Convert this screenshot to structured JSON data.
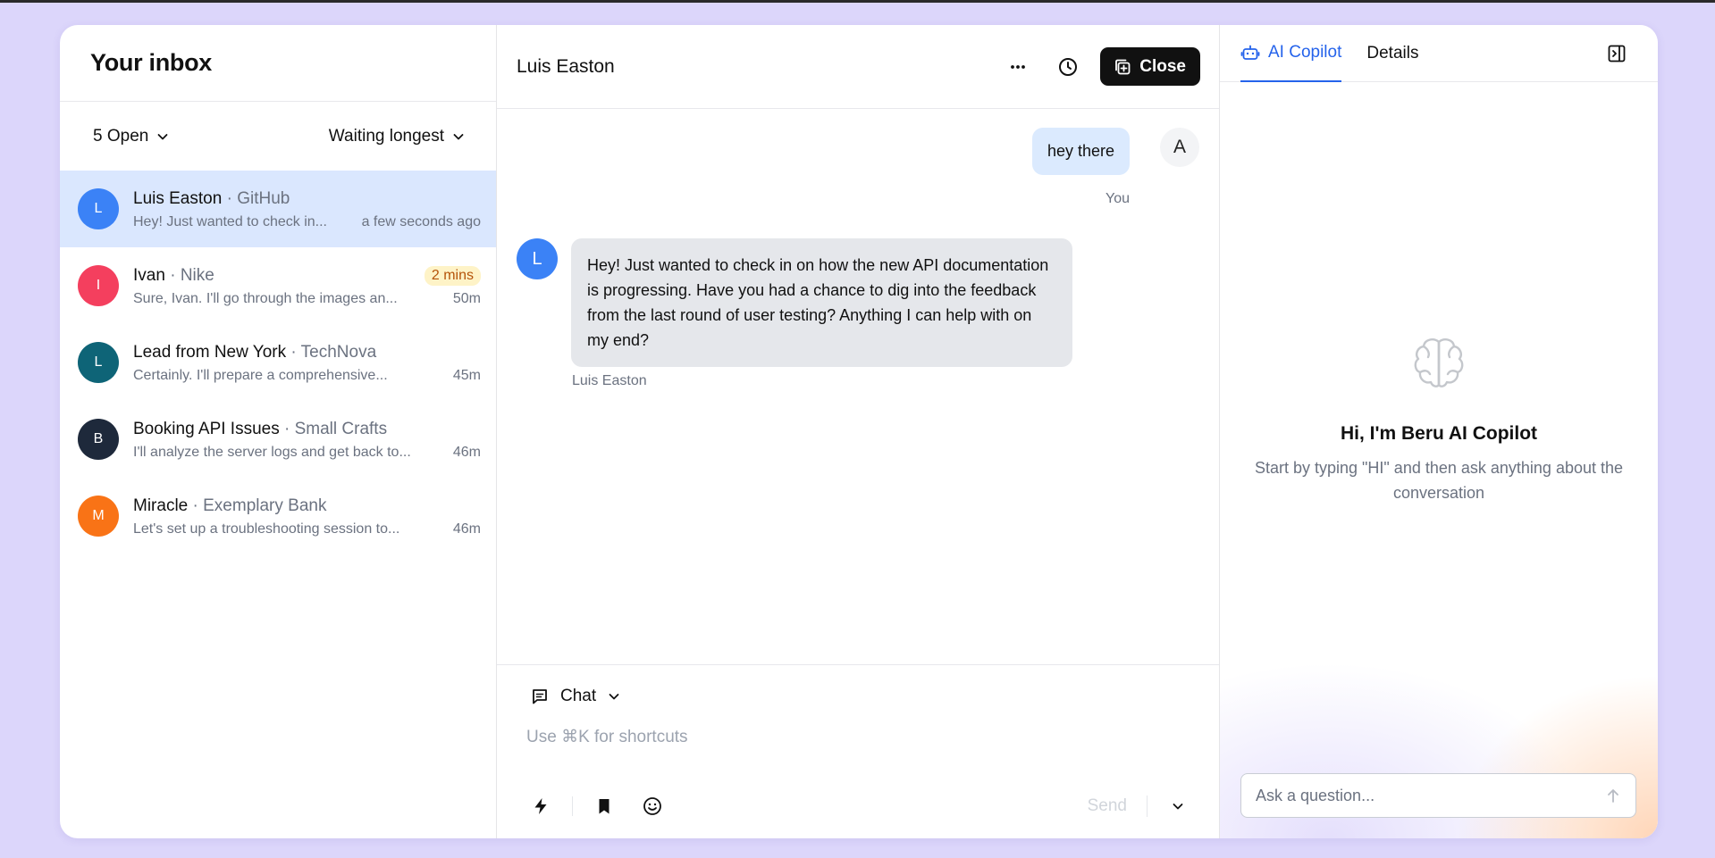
{
  "inbox": {
    "title": "Your inbox",
    "filter_status": "5 Open",
    "sort": "Waiting longest",
    "conversations": [
      {
        "initial": "L",
        "name": "Luis Easton",
        "company": "GitHub",
        "preview": "Hey! Just wanted to check in...",
        "time": "a few seconds ago",
        "badge": "",
        "color": "#3b82f6"
      },
      {
        "initial": "I",
        "name": "Ivan",
        "company": "Nike",
        "preview": "Sure, Ivan. I'll go through the images an...",
        "time": "50m",
        "badge": "2 mins",
        "color": "#f43f5e"
      },
      {
        "initial": "L",
        "name": "Lead from New York",
        "company": "TechNova",
        "preview": "Certainly. I'll prepare a comprehensive...",
        "time": "45m",
        "badge": "",
        "color": "#0e6477"
      },
      {
        "initial": "B",
        "name": "Booking API Issues",
        "company": "Small Crafts",
        "preview": "I'll analyze the server logs and get back to...",
        "time": "46m",
        "badge": "",
        "color": "#1e293b"
      },
      {
        "initial": "M",
        "name": "Miracle",
        "company": "Exemplary Bank",
        "preview": "Let's set up a troubleshooting session to...",
        "time": "46m",
        "badge": "",
        "color": "#f97316"
      }
    ]
  },
  "chat": {
    "title": "Luis Easton",
    "close_label": "Close",
    "outgoing": {
      "text": "hey there",
      "label": "You",
      "avatar": "A"
    },
    "incoming": {
      "avatar": "L",
      "text": "Hey! Just wanted to check in on how the new API documentation is progressing. Have you had a chance to dig into the feedback from the last round of user testing? Anything I can help with on my end?",
      "label": "Luis Easton"
    },
    "composer": {
      "mode": "Chat",
      "placeholder": "Use ⌘K for shortcuts",
      "send": "Send"
    }
  },
  "copilot": {
    "tab_ai": "AI Copilot",
    "tab_details": "Details",
    "title": "Hi, I'm Beru AI Copilot",
    "subtitle": "Start by typing \"HI\" and then ask anything about the conversation",
    "ask_placeholder": "Ask a question...",
    "accent": "#2563eb"
  },
  "icons": [
    "chevron-down-icon",
    "more-icon",
    "clock-icon",
    "close-copy-icon",
    "chat-icon",
    "bolt-icon",
    "bookmark-icon",
    "emoji-icon",
    "robot-icon",
    "panel-collapse-icon",
    "brain-icon",
    "arrow-up-icon"
  ]
}
